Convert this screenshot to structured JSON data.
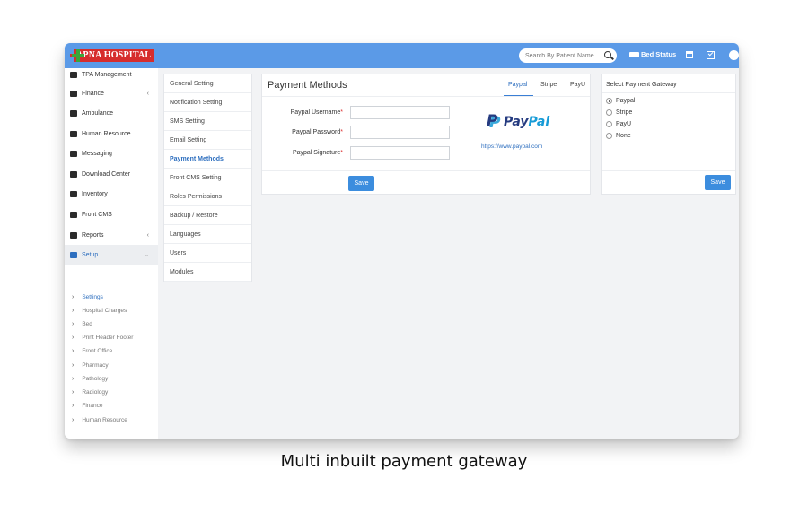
{
  "app": {
    "logo_text": "APNA HOSPITAL"
  },
  "topbar": {
    "search_placeholder": "Search By Patient Name",
    "bed_status_label": "Bed Status"
  },
  "sidebar": {
    "items": [
      {
        "label": "TPA Management",
        "icon": "umbrella-icon"
      },
      {
        "label": "Finance",
        "icon": "money-icon",
        "caret": "‹"
      },
      {
        "label": "Ambulance",
        "icon": "ambulance-icon"
      },
      {
        "label": "Human Resource",
        "icon": "sitemap-icon"
      },
      {
        "label": "Messaging",
        "icon": "bullhorn-icon"
      },
      {
        "label": "Download Center",
        "icon": "download-icon"
      },
      {
        "label": "Inventory",
        "icon": "inventory-icon"
      },
      {
        "label": "Front CMS",
        "icon": "cms-icon"
      },
      {
        "label": "Reports",
        "icon": "line-chart-icon",
        "caret": "‹"
      },
      {
        "label": "Setup",
        "icon": "gears-icon",
        "caret": "⌄"
      }
    ],
    "setup_children": [
      "Settings",
      "Hospital Charges",
      "Bed",
      "Print Header Footer",
      "Front Office",
      "Pharmacy",
      "Pathology",
      "Radiology",
      "Finance",
      "Human Resource"
    ]
  },
  "settings_menu": [
    "General Setting",
    "Notification Setting",
    "SMS Setting",
    "Email Setting",
    "Payment Methods",
    "Front CMS Setting",
    "Roles Permissions",
    "Backup / Restore",
    "Languages",
    "Users",
    "Modules"
  ],
  "payment_panel": {
    "title": "Payment Methods",
    "tabs": [
      "Paypal",
      "Stripe",
      "PayU"
    ],
    "active_tab": "Paypal",
    "fields": [
      {
        "label": "Paypal Username",
        "required": "*",
        "value": ""
      },
      {
        "label": "Paypal Password",
        "required": "*",
        "value": ""
      },
      {
        "label": "Paypal Signature",
        "required": "*",
        "value": ""
      }
    ],
    "brand_pay": "Pay",
    "brand_pal": "Pal",
    "brand_mark": "P",
    "brand_url": "https://www.paypal.com",
    "save_label": "Save"
  },
  "gateway_panel": {
    "title": "Select Payment Gateway",
    "options": [
      "Paypal",
      "Stripe",
      "PayU",
      "None"
    ],
    "selected": "Paypal",
    "save_label": "Save"
  },
  "caption": "Multi inbuilt payment gateway",
  "colors": {
    "topbar": "#5b9ae7",
    "accent": "#2e6fbf",
    "button": "#3c8dde",
    "logo_red": "#d62d2d"
  }
}
